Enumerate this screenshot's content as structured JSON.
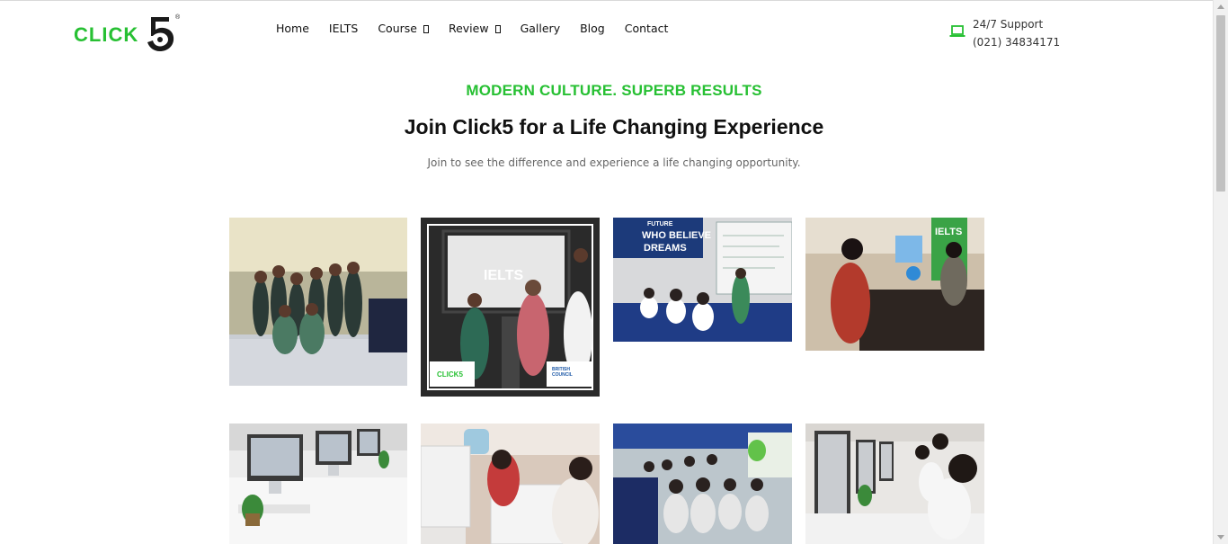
{
  "brand": {
    "logo_text": "CLICK",
    "logo_number": "5",
    "logo_reg": "®",
    "color": "#27c033"
  },
  "nav": {
    "items": [
      {
        "label": "Home",
        "has_dropdown": false
      },
      {
        "label": "IELTS",
        "has_dropdown": false
      },
      {
        "label": "Course",
        "has_dropdown": true
      },
      {
        "label": "Review",
        "has_dropdown": true
      },
      {
        "label": "Gallery",
        "has_dropdown": false
      },
      {
        "label": "Blog",
        "has_dropdown": false
      },
      {
        "label": "Contact",
        "has_dropdown": false
      }
    ]
  },
  "support": {
    "icon": "laptop-icon",
    "label": "24/7 Support",
    "phone": "(021) 34834171"
  },
  "hero": {
    "kicker": "MODERN CULTURE. SUPERB RESULTS",
    "headline": "Join Click5 for a Life Changing Experience",
    "subtext": "Join to see the difference and experience a life changing opportunity."
  },
  "gallery": {
    "photos": [
      {
        "name": "gallery-photo-group-staff"
      },
      {
        "name": "gallery-photo-ielts-certificate",
        "captions": [
          "IELTS",
          "CLICK5",
          "BRITISH COUNCIL"
        ]
      },
      {
        "name": "gallery-photo-classroom-whiteboard",
        "captions": [
          "FUTURE",
          "WHO BELIEVE",
          "DREAMS"
        ]
      },
      {
        "name": "gallery-photo-reception-desk",
        "captions": [
          "IELTS"
        ]
      },
      {
        "name": "gallery-photo-computer-lab"
      },
      {
        "name": "gallery-photo-students-imacs"
      },
      {
        "name": "gallery-photo-students-class"
      },
      {
        "name": "gallery-photo-lab-students"
      }
    ]
  }
}
